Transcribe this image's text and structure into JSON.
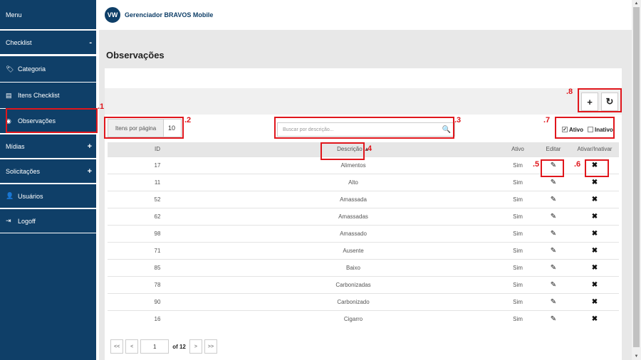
{
  "sidebar": {
    "menu_label": "Menu",
    "checklist_label": "Checklist",
    "checklist_toggle": "-",
    "items": [
      {
        "label": "Categoria",
        "icon": "tag-icon"
      },
      {
        "label": "Itens Checklist",
        "icon": "list-icon"
      },
      {
        "label": "Observações",
        "icon": "eye-icon"
      }
    ],
    "midias_label": "Mídias",
    "solicitacoes_label": "Solicitações",
    "usuarios_label": "Usuários",
    "logoff_label": "Logoff",
    "expand_symbol": "+"
  },
  "header": {
    "title": "Gerenciador BRAVOS Mobile",
    "logo_text": "VW"
  },
  "page": {
    "title": "Observações"
  },
  "toolbar": {
    "add_symbol": "+",
    "refresh_symbol": "↻"
  },
  "filters": {
    "items_per_page_label": "Itens por página",
    "items_per_page_value": "10",
    "search_placeholder": "Buscar por descrição...",
    "ativo_label": "Ativo",
    "ativo_checked": true,
    "inativo_label": "Inativo",
    "inativo_checked": false
  },
  "table": {
    "headers": {
      "id": "ID",
      "descricao": "Descrição ▲",
      "ativo": "Ativo",
      "editar": "Editar",
      "ativar": "Ativar/Inativar"
    },
    "rows": [
      {
        "id": "17",
        "descricao": "Alimentos",
        "ativo": "Sim"
      },
      {
        "id": "11",
        "descricao": "Alto",
        "ativo": "Sim"
      },
      {
        "id": "52",
        "descricao": "Amassada",
        "ativo": "Sim"
      },
      {
        "id": "62",
        "descricao": "Amassadas",
        "ativo": "Sim"
      },
      {
        "id": "98",
        "descricao": "Amassado",
        "ativo": "Sim"
      },
      {
        "id": "71",
        "descricao": "Ausente",
        "ativo": "Sim"
      },
      {
        "id": "85",
        "descricao": "Baixo",
        "ativo": "Sim"
      },
      {
        "id": "78",
        "descricao": "Carbonizadas",
        "ativo": "Sim"
      },
      {
        "id": "90",
        "descricao": "Carbonizado",
        "ativo": "Sim"
      },
      {
        "id": "16",
        "descricao": "Cigarro",
        "ativo": "Sim"
      }
    ]
  },
  "pagination": {
    "first": "<<",
    "prev": "<",
    "current": "1",
    "of_label": "of 12",
    "next": ">",
    "last": ">>"
  },
  "annotations": [
    ".1",
    ".2",
    ".3",
    ".4",
    ".5",
    ".6",
    ".7",
    ".8"
  ],
  "colors": {
    "sidebar": "#0f3f68",
    "annotation": "#e0161c",
    "main_bg": "#e8e8e8"
  }
}
